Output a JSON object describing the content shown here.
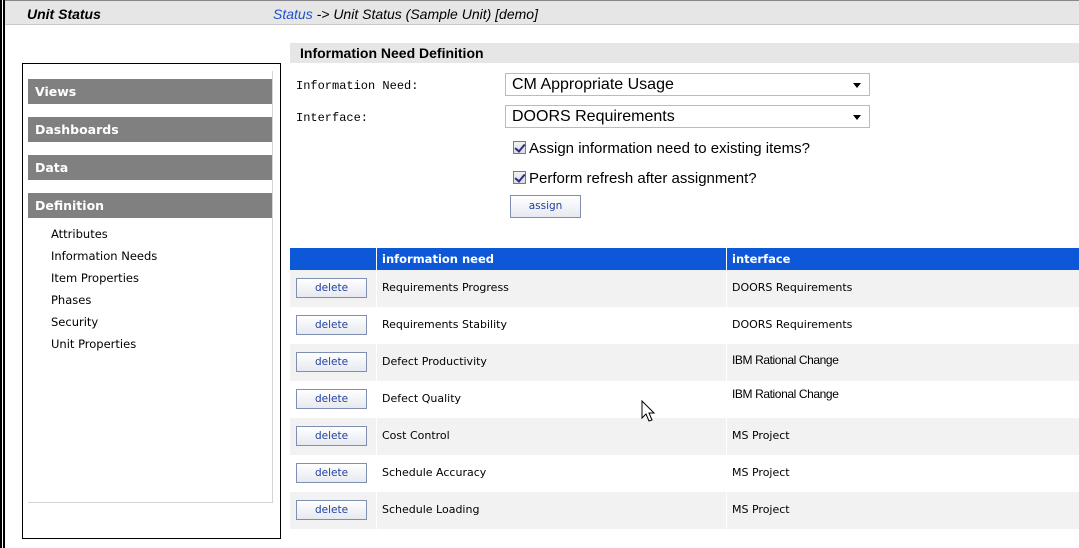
{
  "header": {
    "unit_title": "Unit Status",
    "breadcrumb_link": "Status",
    "breadcrumb_rest": " -> Unit Status (Sample Unit) [demo]"
  },
  "section": {
    "title": "Information Need Definition"
  },
  "nav": {
    "views": "Views",
    "dashboards": "Dashboards",
    "data": "Data",
    "definition": "Definition",
    "items": [
      "Attributes",
      "Information Needs",
      "Item Properties",
      "Phases",
      "Security",
      "Unit Properties"
    ]
  },
  "form": {
    "info_need_label": "Information Need:",
    "info_need_value": "CM Appropriate Usage",
    "interface_label": "Interface:",
    "interface_value": "DOORS Requirements",
    "assign_existing_label": "Assign information need to existing items?",
    "refresh_label": "Perform refresh after assignment?",
    "assign_button": "assign"
  },
  "table": {
    "headers": {
      "need": "information need",
      "interface": "interface"
    },
    "delete_label": "delete",
    "rows": [
      {
        "need": "Requirements Progress",
        "interface": "DOORS Requirements"
      },
      {
        "need": "Requirements Stability",
        "interface": "DOORS Requirements"
      },
      {
        "need": "Defect Productivity",
        "interface": "IBM Rational Change"
      },
      {
        "need": "Defect Quality",
        "interface": "IBM Rational Change"
      },
      {
        "need": "Cost Control",
        "interface": "MS Project"
      },
      {
        "need": "Schedule Accuracy",
        "interface": "MS Project"
      },
      {
        "need": "Schedule Loading",
        "interface": "MS Project"
      }
    ]
  },
  "icons": {
    "cursor": "mouse-pointer-icon",
    "dropdown": "chevron-down-icon",
    "checkbox": "checkbox-checked-icon"
  }
}
